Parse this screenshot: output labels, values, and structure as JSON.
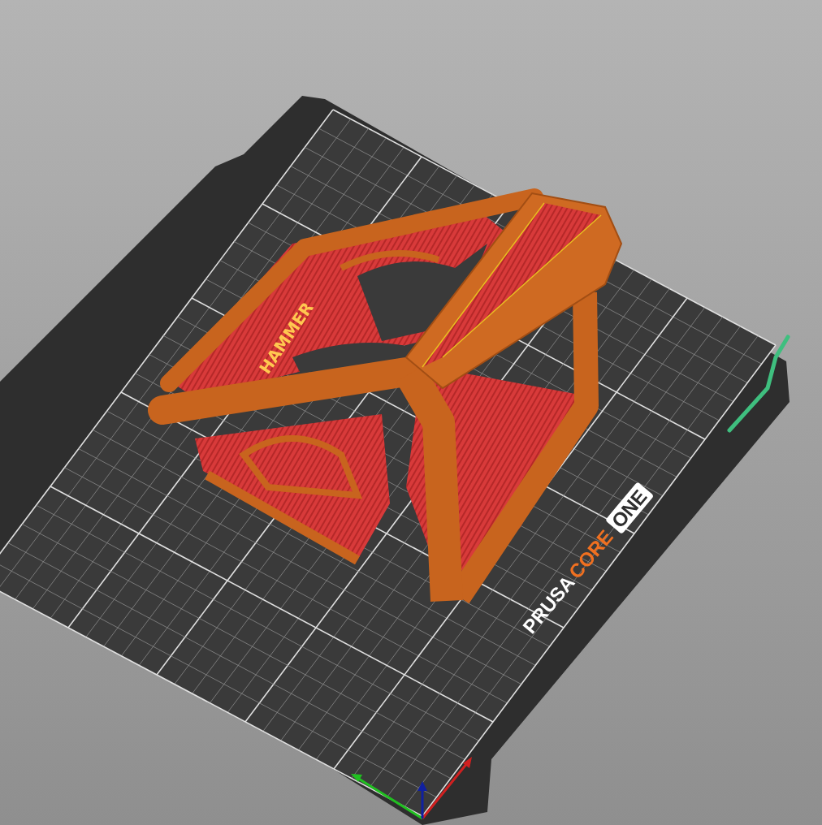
{
  "bed": {
    "logo": [
      {
        "text": "PRUSA",
        "kind": "plain"
      },
      {
        "text": "CORE",
        "kind": "accent"
      },
      {
        "text": "ONE",
        "kind": "boxed"
      }
    ]
  },
  "model": {
    "label": "HAMMER"
  }
}
